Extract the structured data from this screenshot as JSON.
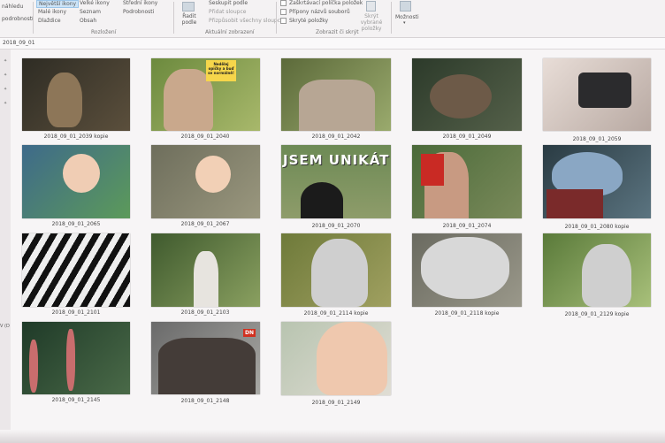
{
  "ribbon": {
    "left_labels": [
      "náhledu",
      "podrobností"
    ],
    "layout_items": [
      "Největší ikony",
      "Velké ikony",
      "Střední ikony",
      "Malé ikony",
      "Seznam",
      "Podrobnosti",
      "Dlaždice",
      "Obsah"
    ],
    "sort_button_label": "Řadit podle",
    "current_view_items": [
      "Seskupit podle",
      "Přidat sloupce",
      "Přizpůsobit všechny sloupce"
    ],
    "checkboxes": [
      "Zaškrtávací políčka položek",
      "Přípony názvů souborů",
      "Skryté položky"
    ],
    "hide_selected_label": "Skrýt vybrané položky",
    "options_label": "Možnosti",
    "groups": {
      "layout": "Rozložení",
      "current_view": "Aktuální zobrazení",
      "show_hide": "Zobrazit či skrýt"
    }
  },
  "address": {
    "path": "2018_09_01"
  },
  "sidebar": {
    "label": "V (D"
  },
  "files": [
    {
      "name": "2018_09_01_2039 kopie"
    },
    {
      "name": "2018_09_01_2040",
      "overlay": "Nedělej opičky a buď se normálně!"
    },
    {
      "name": "2018_09_01_2042"
    },
    {
      "name": "2018_09_01_2049"
    },
    {
      "name": "2018_09_01_2059"
    },
    {
      "name": "2018_09_01_2065"
    },
    {
      "name": "2018_09_01_2067"
    },
    {
      "name": "2018_09_01_2070",
      "overlay": "JSEM UNIKÁT"
    },
    {
      "name": "2018_09_01_2074"
    },
    {
      "name": "2018_09_01_2080 kopie"
    },
    {
      "name": "2018_09_01_2101"
    },
    {
      "name": "2018_09_01_2103"
    },
    {
      "name": "2018_09_01_2114 kopie"
    },
    {
      "name": "2018_09_01_2118 kopie"
    },
    {
      "name": "2018_09_01_2129 kopie"
    },
    {
      "name": "2018_09_01_2145"
    },
    {
      "name": "2018_09_01_2148",
      "overlay": "DN"
    },
    {
      "name": "2018_09_01_2149"
    }
  ]
}
